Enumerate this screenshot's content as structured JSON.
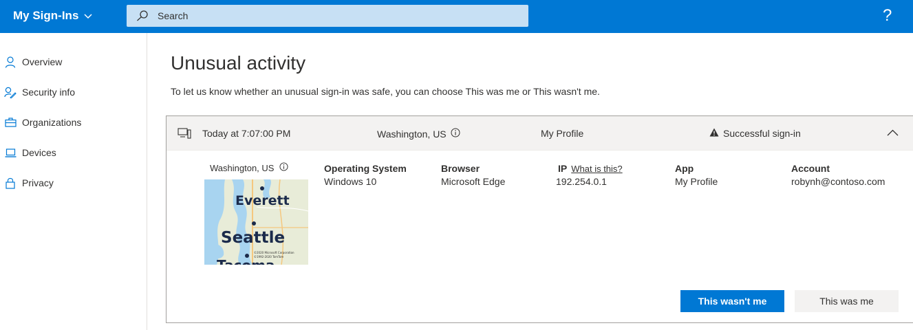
{
  "header": {
    "app_title": "My Sign-Ins",
    "search_placeholder": "Search",
    "help_label": "?"
  },
  "sidebar": {
    "items": [
      {
        "label": "Overview",
        "icon": "person-icon"
      },
      {
        "label": "Security info",
        "icon": "security-info-icon"
      },
      {
        "label": "Organizations",
        "icon": "briefcase-icon"
      },
      {
        "label": "Devices",
        "icon": "laptop-icon"
      },
      {
        "label": "Privacy",
        "icon": "lock-icon"
      }
    ]
  },
  "main": {
    "title": "Unusual activity",
    "description": "To let us know whether an unusual sign-in was safe, you can choose This was me or This wasn't me."
  },
  "signin": {
    "time": "Today at 7:07:00 PM",
    "location": "Washington, US",
    "app": "My Profile",
    "status": "Successful sign-in",
    "details": {
      "location": "Washington, US",
      "os_label": "Operating System",
      "os_value": "Windows 10",
      "browser_label": "Browser",
      "browser_value": "Microsoft Edge",
      "ip_label": "IP",
      "ip_link": "What is this?",
      "ip_value": "192.254.0.1",
      "app_label": "App",
      "app_value": "My Profile",
      "account_label": "Account",
      "account_value": "robynh@contoso.com"
    },
    "map": {
      "city1": "Everett",
      "city2": "Seattle",
      "city3": "Tacoma",
      "copyright1": "©2020 Microsoft Corporation",
      "copyright2": "©1992-2020 TomTom"
    },
    "actions": {
      "not_me": "This wasn't me",
      "was_me": "This was me"
    }
  },
  "colors": {
    "brand": "#0078d4",
    "search_bg": "#c7e0f4",
    "card_header_bg": "#f3f2f1"
  }
}
